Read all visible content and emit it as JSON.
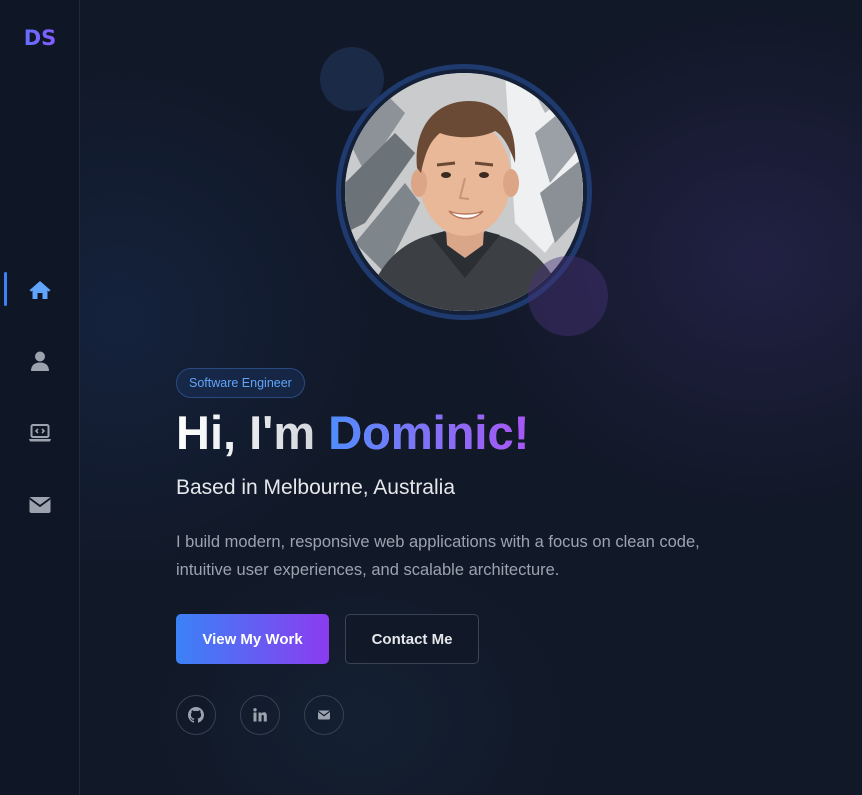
{
  "logo": "DS",
  "sidebar": {
    "items": [
      {
        "icon": "home-icon",
        "active": true
      },
      {
        "icon": "user-icon",
        "active": false
      },
      {
        "icon": "laptop-code-icon",
        "active": false
      },
      {
        "icon": "envelope-icon",
        "active": false
      }
    ]
  },
  "hero": {
    "badge": "Software Engineer",
    "greeting": "Hi, I'm ",
    "name": "Dominic!",
    "location": "Based in Melbourne, Australia",
    "bio_line1": "I build modern, responsive web applications with a focus on clean code,",
    "bio_line2": "intuitive user experiences, and scalable architecture.",
    "primary_button": "View My Work",
    "secondary_button": "Contact Me",
    "avatar_alt": "Profile photo"
  },
  "social": [
    "github-icon",
    "linkedin-icon",
    "mail-icon"
  ],
  "colors": {
    "background": "#111827",
    "accent_blue": "#3b82f6",
    "accent_purple": "#8b3cf0",
    "active_nav": "#3b82f6",
    "muted_icon": "#9ca3af"
  }
}
